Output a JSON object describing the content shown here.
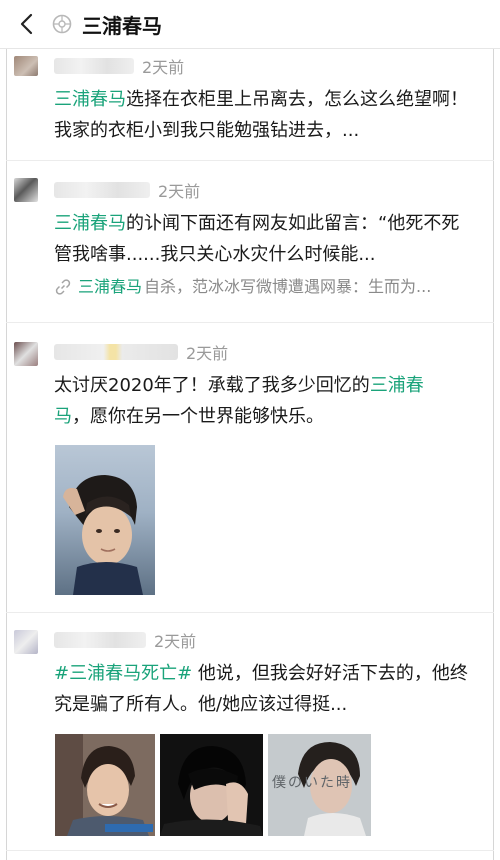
{
  "header": {
    "title": "三浦春马"
  },
  "colors": {
    "highlight": "#1aa37a",
    "time": "#9a9a9a"
  },
  "posts": [
    {
      "time": "2天前",
      "text": {
        "hl": "三浦春马",
        "rest": "选择在衣柜里上吊离去，怎么这么绝望啊！我家的衣柜小到我只能勉强钻进去，..."
      }
    },
    {
      "time": "2天前",
      "text": {
        "hl": "三浦春马",
        "rest": "的讣闻下面还有网友如此留言：“他死不死管我啥事......我只关心水灾什么时候能..."
      },
      "link": {
        "hl": "三浦春马",
        "rest": "自杀，范冰冰写微博遭遇网暴：生而为..."
      }
    },
    {
      "time": "2天前",
      "text": {
        "pre": "太讨厌2020年了！承载了我多少回忆的",
        "hl": "三浦春",
        "hl2": "马",
        "rest": "，愿你在另一个世界能够快乐。"
      }
    },
    {
      "time": "2天前",
      "text": {
        "hl": "#三浦春马死亡#",
        "rest": " 他说，但我会好好活下去的，他终究是骗了所有人。他/她应该过得挺..."
      },
      "photo_caption": "僕のいた時"
    }
  ]
}
